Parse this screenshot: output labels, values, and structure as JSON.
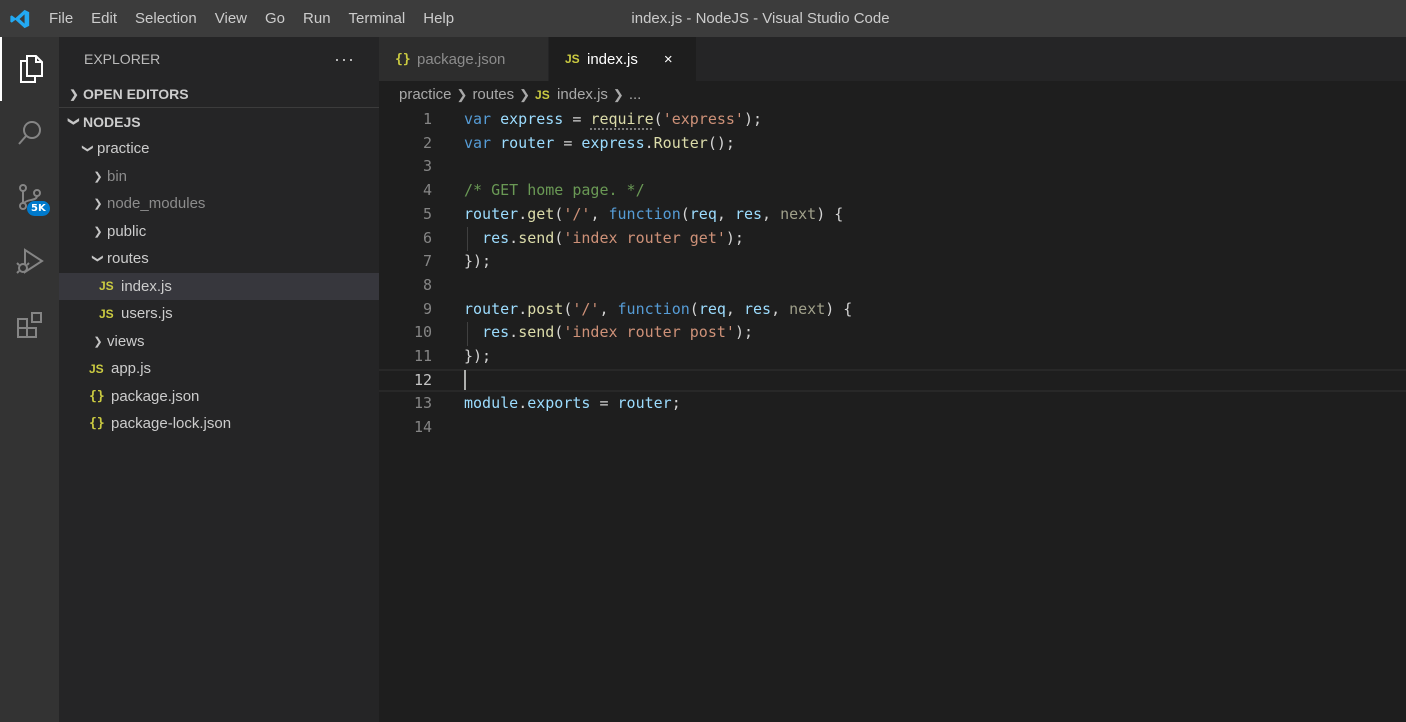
{
  "window": {
    "title": "index.js - NodeJS - Visual Studio Code",
    "menu": [
      "File",
      "Edit",
      "Selection",
      "View",
      "Go",
      "Run",
      "Terminal",
      "Help"
    ]
  },
  "activity_bar": {
    "items": [
      {
        "name": "explorer-icon",
        "active": true
      },
      {
        "name": "search-icon",
        "active": false
      },
      {
        "name": "source-control-icon",
        "active": false,
        "badge": "5K"
      },
      {
        "name": "run-debug-icon",
        "active": false
      },
      {
        "name": "extensions-icon",
        "active": false
      }
    ],
    "source_control_badge": "5K"
  },
  "sidebar": {
    "title": "EXPLORER",
    "more": "···",
    "open_editors": "OPEN EDITORS",
    "workspace": "NODEJS",
    "tree": [
      {
        "label": "practice",
        "type": "folder",
        "expanded": true
      },
      {
        "label": "bin",
        "type": "folder",
        "expanded": false
      },
      {
        "label": "node_modules",
        "type": "folder",
        "expanded": false
      },
      {
        "label": "public",
        "type": "folder",
        "expanded": false
      },
      {
        "label": "routes",
        "type": "folder",
        "expanded": true
      },
      {
        "label": "index.js",
        "type": "js",
        "selected": true
      },
      {
        "label": "users.js",
        "type": "js"
      },
      {
        "label": "views",
        "type": "folder",
        "expanded": false
      },
      {
        "label": "app.js",
        "type": "js"
      },
      {
        "label": "package.json",
        "type": "json"
      },
      {
        "label": "package-lock.json",
        "type": "json"
      }
    ]
  },
  "tabs": [
    {
      "label": "package.json",
      "icon": "{}",
      "active": false
    },
    {
      "label": "index.js",
      "icon": "JS",
      "active": true,
      "close": "×"
    }
  ],
  "breadcrumb": {
    "items": [
      "practice",
      "routes",
      "index.js",
      "..."
    ],
    "file_icon": "JS"
  },
  "editor": {
    "current_line": 12,
    "lines": [
      "var express = require('express');",
      "var router = express.Router();",
      "",
      "/* GET home page. */",
      "router.get('/', function(req, res, next) {",
      "  res.send('index router get');",
      "});",
      "",
      "router.post('/', function(req, res, next) {",
      "  res.send('index router post');",
      "});",
      "",
      "module.exports = router;",
      ""
    ]
  },
  "colors": {
    "keyword": "#569cd6",
    "variable": "#9cdcfe",
    "function": "#dcdcaa",
    "string": "#ce9178",
    "comment": "#6a9955",
    "accent": "#007acc"
  }
}
